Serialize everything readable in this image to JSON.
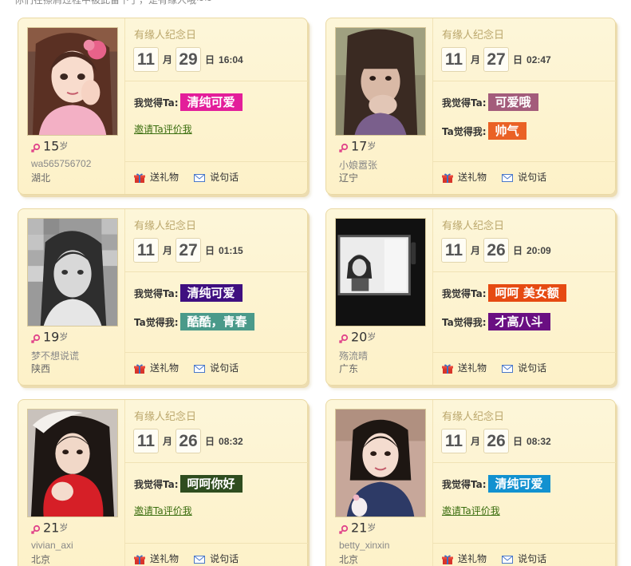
{
  "header": {
    "partial_text": "你们在擦肩过程中被此留下了，是有缘人哦~~"
  },
  "labels": {
    "card_title": "有缘人纪念日",
    "month_unit": "月",
    "day_unit": "日",
    "i_think": "我觉得Ta:",
    "ta_thinks": "Ta觉得我:",
    "invite": "邀请Ta评价我",
    "gift": "送礼物",
    "message": "说句话",
    "age_unit": "岁"
  },
  "colors": {
    "card_bg": "#fdf4d0",
    "title": "#bba76c",
    "invite_link": "#3b6e10",
    "gender_female": "#e0448a"
  },
  "cards": [
    {
      "age": "15",
      "username": "wa565756702",
      "city": "湖北",
      "month": "11",
      "day": "29",
      "time": "16:04",
      "i_think": {
        "text": "清纯可爱",
        "color": "#e31e9a"
      },
      "ta_thinks": null,
      "photo": "portrait-pink-bow"
    },
    {
      "age": "17",
      "username": "小娘嚣张",
      "city": "辽宁",
      "month": "11",
      "day": "27",
      "time": "02:47",
      "i_think": {
        "text": "可爱哦",
        "color": "#a35c7b"
      },
      "ta_thinks": {
        "text": "帅气",
        "color": "#ea6125"
      },
      "photo": "portrait-dark-hair"
    },
    {
      "age": "19",
      "username": "梦不想说谎",
      "city": "陕西",
      "month": "11",
      "day": "27",
      "time": "01:15",
      "i_think": {
        "text": "清纯可爱",
        "color": "#3f0f80"
      },
      "ta_thinks": {
        "text": "酷酷，青春",
        "color": "#4a9a8a"
      },
      "photo": "portrait-grayscale"
    },
    {
      "age": "20",
      "username": "殇流晴",
      "city": "广东",
      "month": "11",
      "day": "26",
      "time": "20:09",
      "i_think": {
        "text": "呵呵 美女额",
        "color": "#e64a12"
      },
      "ta_thinks": {
        "text": "才高八斗",
        "color": "#6a0f82"
      },
      "photo": "portrait-phone-frame"
    },
    {
      "age": "21",
      "username": "vivian_axi",
      "city": "北京",
      "month": "11",
      "day": "26",
      "time": "08:32",
      "i_think": {
        "text": "呵呵你好",
        "color": "#2f4d1f"
      },
      "ta_thinks": null,
      "photo": "portrait-red-scarf"
    },
    {
      "age": "21",
      "username": "betty_xinxin",
      "city": "北京",
      "month": "11",
      "day": "26",
      "time": "08:32",
      "i_think": {
        "text": "清纯可爱",
        "color": "#1291d0"
      },
      "ta_thinks": null,
      "photo": "portrait-blue-jacket"
    }
  ]
}
